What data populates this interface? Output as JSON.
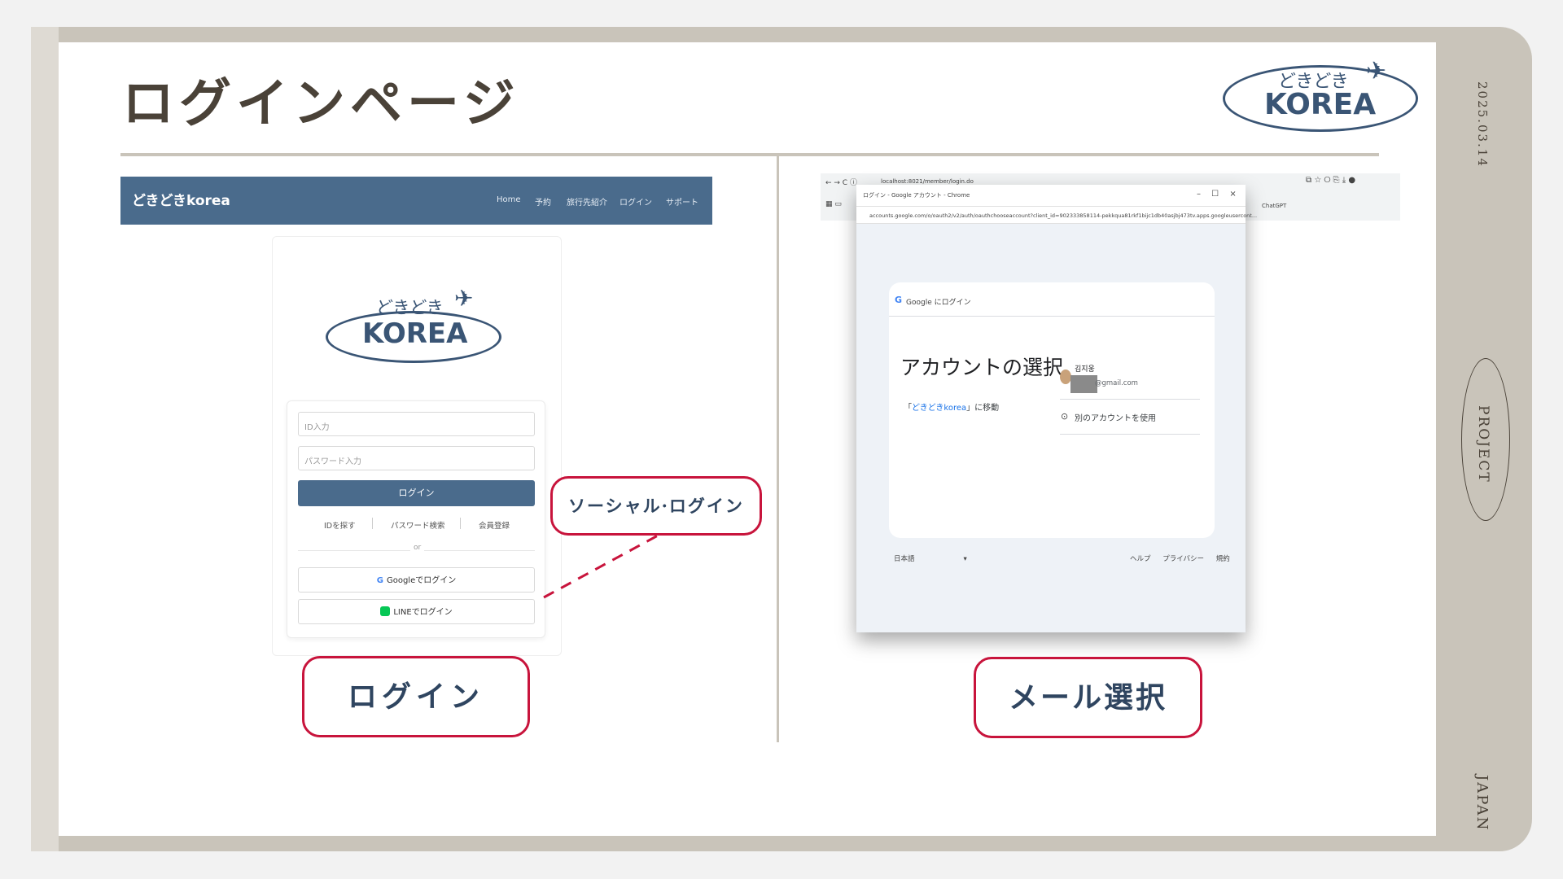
{
  "slide": {
    "title": "ログインページ",
    "date": "2025.03.14",
    "project_label": "PROJECT",
    "country_label": "JAPAN",
    "logo": {
      "top": "どきどき",
      "main": "KOREA"
    },
    "colors": {
      "frame": "#c9c4ba",
      "navy": "#3a5575",
      "accent_red": "#c8143c"
    }
  },
  "login_screenshot": {
    "brand": "どきどきkorea",
    "nav_items": [
      "Home",
      "予約",
      "旅行先紹介",
      "ログイン",
      "サポート"
    ],
    "logo": {
      "top": "どきどき",
      "main": "KOREA"
    },
    "id_placeholder": "ID入力",
    "password_placeholder": "パスワード入力",
    "login_button": "ログイン",
    "links": [
      "IDを探す",
      "パスワード検索",
      "会員登録"
    ],
    "or": "or",
    "google_login": "Googleでログイン",
    "line_login": "LINEでログイン"
  },
  "callouts": {
    "social": "ソーシャル·ログイン",
    "login": "ログイン",
    "mail": "メール選択"
  },
  "google_screenshot": {
    "address_bar": "localhost:8021/member/login.do",
    "bookmark": "ChatGPT",
    "popup_title": "ログイン - Google アカウント - Chrome",
    "popup_url": "accounts.google.com/o/oauth2/v2/auth/oauthchooseaccount?client_id=902333858114-pekkqua81rkf1bijc1db40asjbj473tv.apps.googleusercont...",
    "card_header": "Google にログイン",
    "heading": "アカウントの選択",
    "continue_prefix": "「",
    "continue_link": "どきどきkorea",
    "continue_suffix": "」に移動",
    "account_name": "김지웅",
    "account_email": "@gmail.com",
    "other_account": "別のアカウントを使用",
    "language": "日本語",
    "footer_links": "ヘルプ プライバシー 規約"
  }
}
